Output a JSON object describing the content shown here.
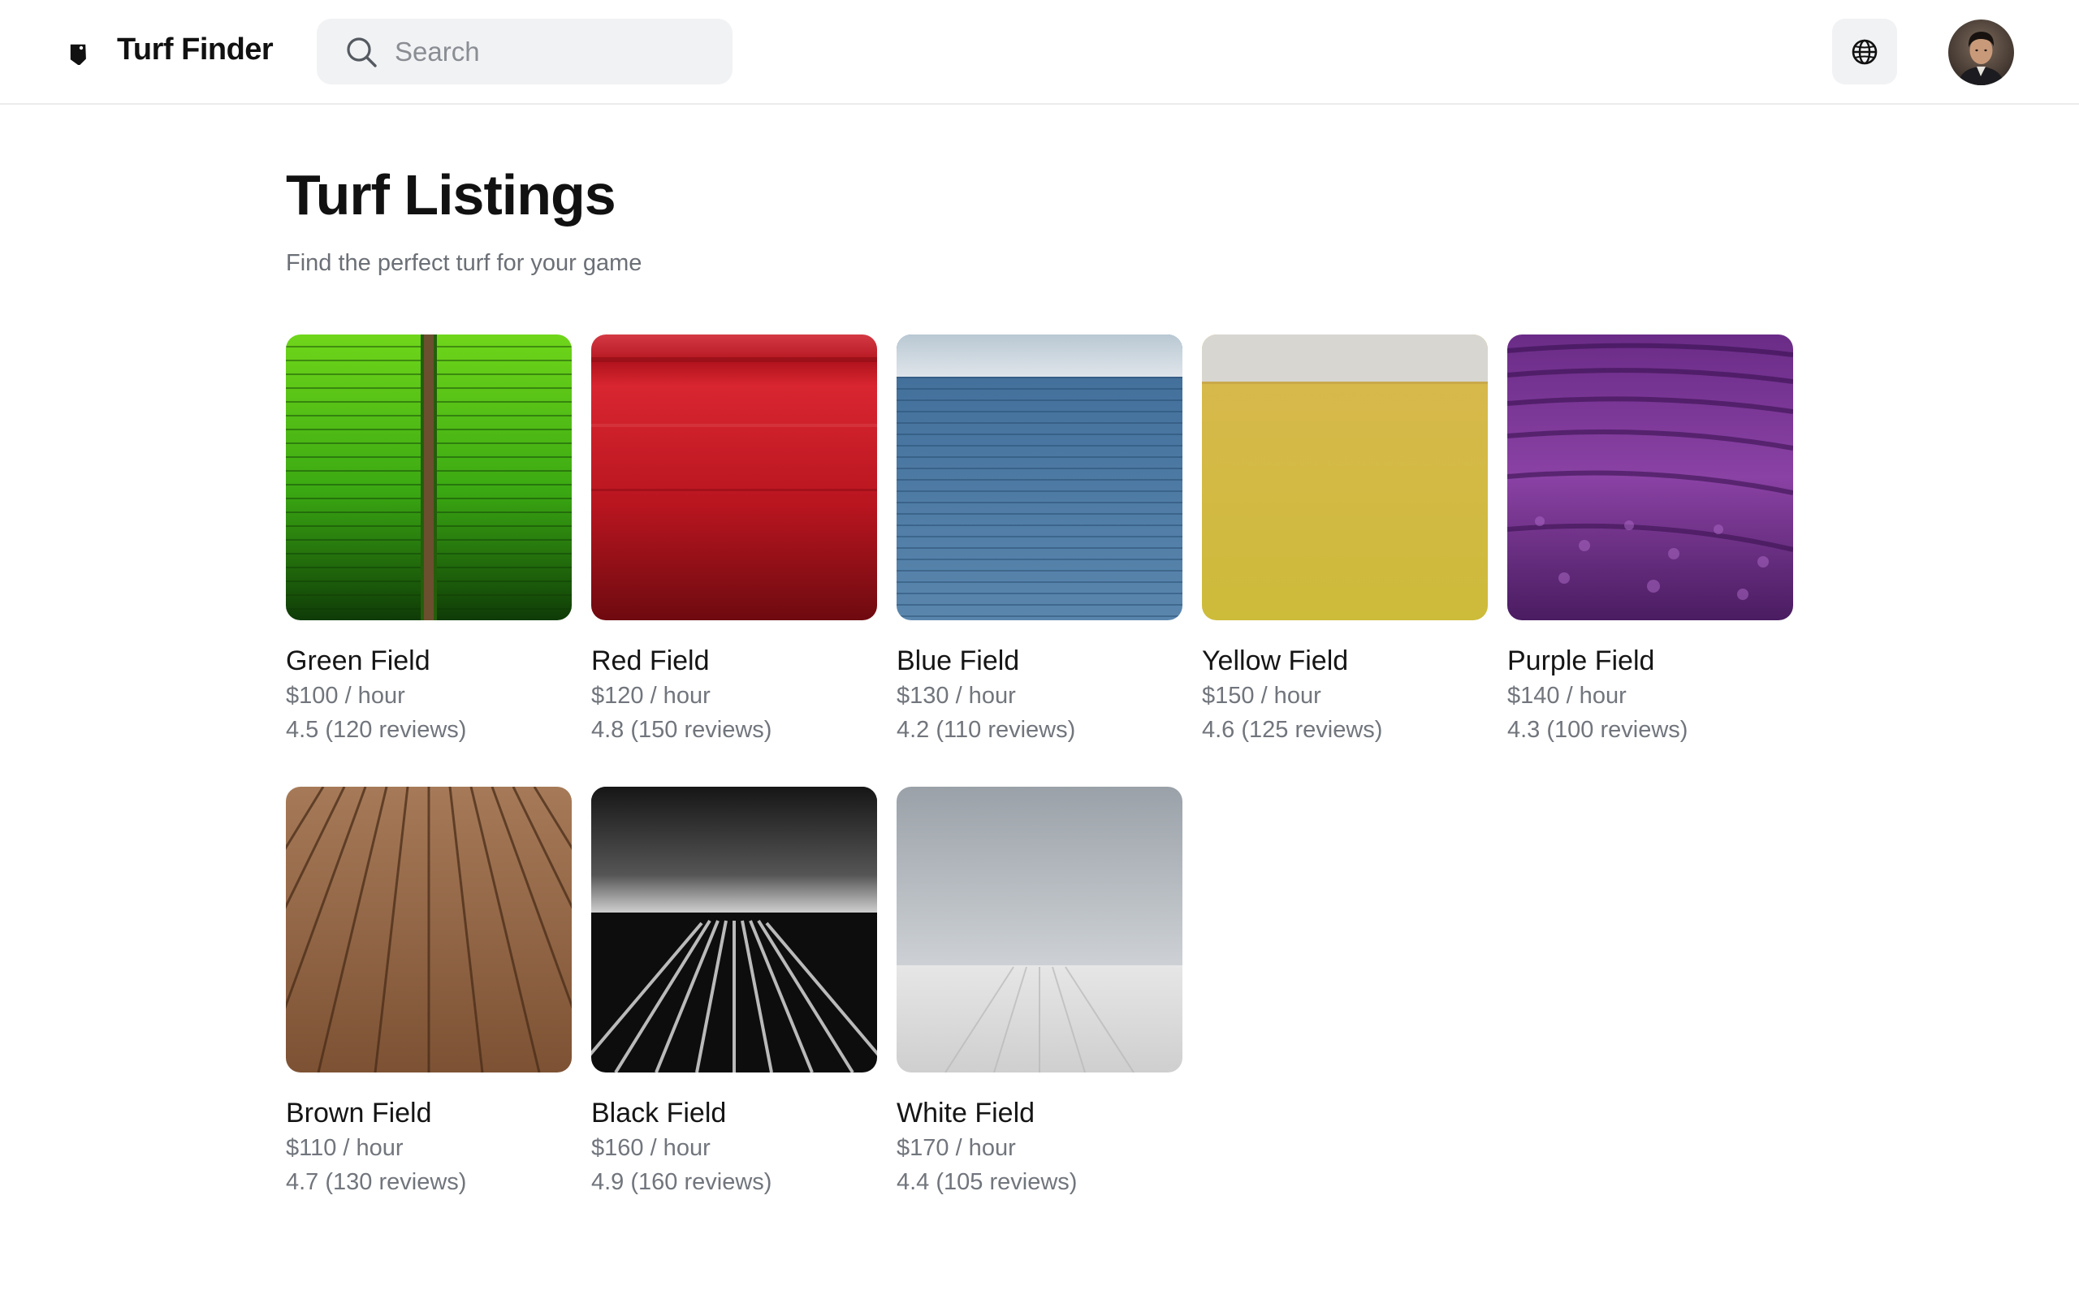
{
  "header": {
    "brand": "Turf Finder",
    "search_placeholder": "Search"
  },
  "main": {
    "title": "Turf Listings",
    "subtitle": "Find the perfect turf for your game",
    "listings": [
      {
        "name": "Green Field",
        "price": "$100 / hour",
        "rating": "4.5 (120 reviews)",
        "color": "#3fae12"
      },
      {
        "name": "Red Field",
        "price": "$120 / hour",
        "rating": "4.8 (150 reviews)",
        "color": "#c21d27"
      },
      {
        "name": "Blue Field",
        "price": "$130 / hour",
        "rating": "4.2 (110 reviews)",
        "color": "#4a77a3"
      },
      {
        "name": "Yellow Field",
        "price": "$150 / hour",
        "rating": "4.6 (125 reviews)",
        "color": "#d6bd3c"
      },
      {
        "name": "Purple Field",
        "price": "$140 / hour",
        "rating": "4.3 (100 reviews)",
        "color": "#7a3592"
      },
      {
        "name": "Brown Field",
        "price": "$110 / hour",
        "rating": "4.7 (130 reviews)",
        "color": "#98694a"
      },
      {
        "name": "Black Field",
        "price": "$160 / hour",
        "rating": "4.9 (160 reviews)",
        "color": "#1d1d1d"
      },
      {
        "name": "White Field",
        "price": "$170 / hour",
        "rating": "4.4 (105 reviews)",
        "color": "#e4e5e6"
      }
    ]
  },
  "icons": {
    "logo": "tag-icon",
    "search": "search-icon",
    "language": "globe-icon",
    "profile": "avatar"
  }
}
